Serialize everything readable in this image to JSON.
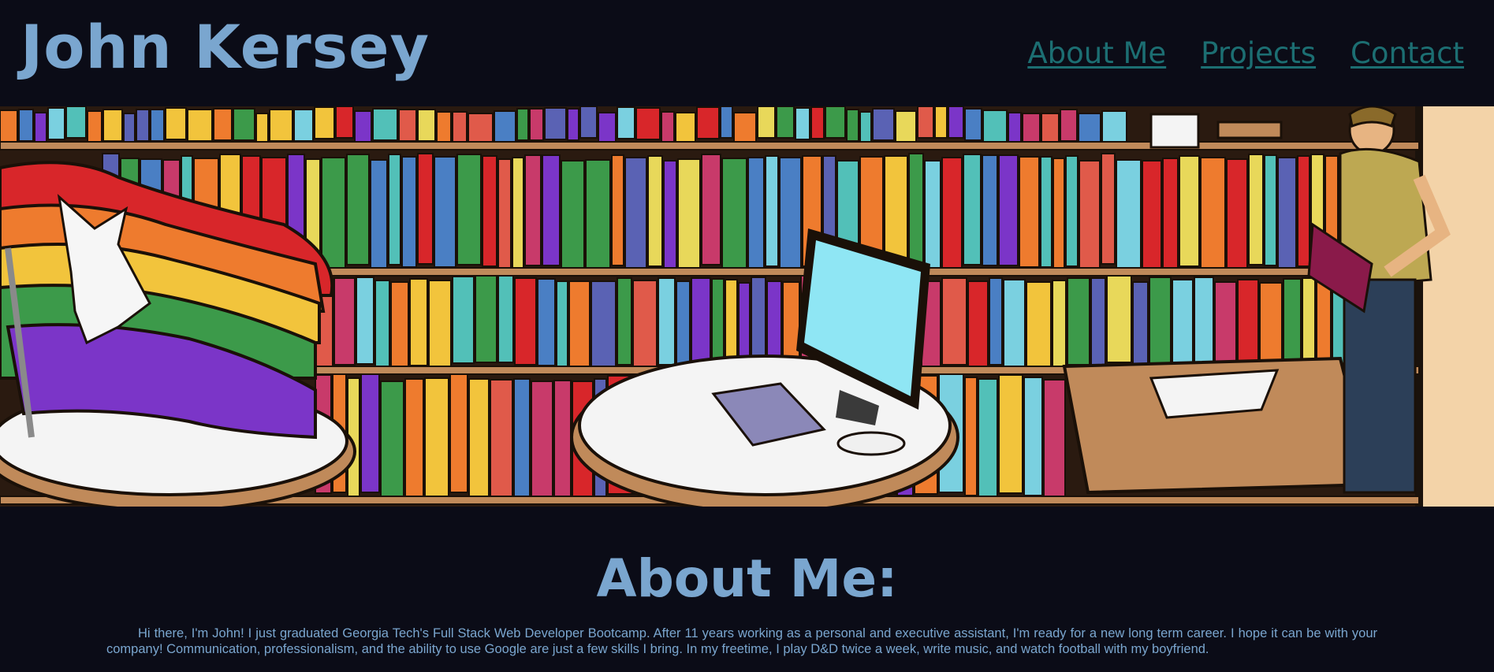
{
  "header": {
    "title": "John Kersey",
    "nav": [
      {
        "label": "About Me"
      },
      {
        "label": "Projects"
      },
      {
        "label": "Contact"
      }
    ]
  },
  "hero": {
    "icon": "library-illustration",
    "palette": {
      "shelf": "#c08a5a",
      "background": "#2a1a10",
      "wall": "#f3d3a8",
      "table": "#f4f4f4",
      "screen": "#8fe6f4"
    }
  },
  "about": {
    "heading": "About Me:",
    "body": "Hi there, I'm John! I just graduated Georgia Tech's Full Stack Web Developer Bootcamp. After 11 years working as a personal and executive assistant, I'm ready for a new long term career. I hope it can be with your company! Communication, professionalism, and the ability to use Google are just a few skills I bring. In my freetime, I play D&D twice a week, write music, and watch football with my boyfriend."
  },
  "colors": {
    "background": "#0b0c17",
    "title": "#7aa6cf",
    "nav_link": "#1c6e72"
  }
}
